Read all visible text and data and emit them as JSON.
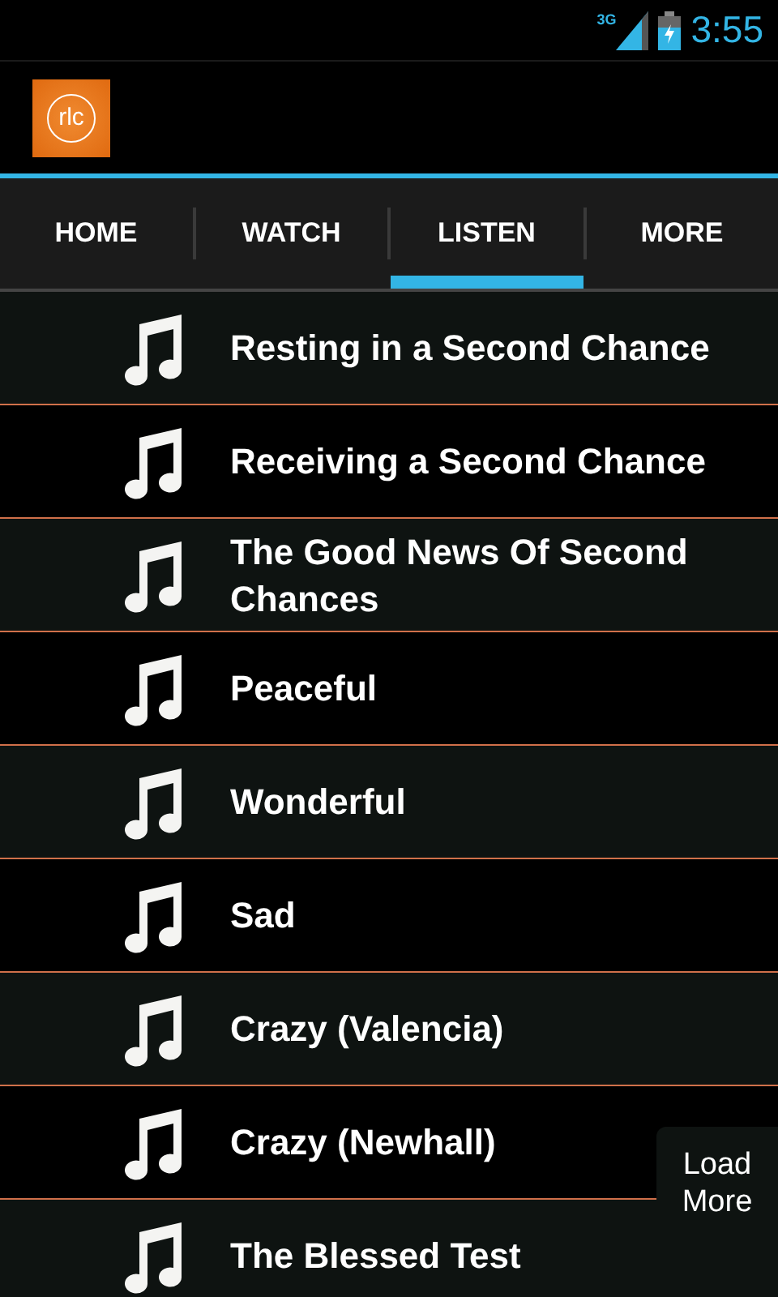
{
  "status_bar": {
    "network": "3G",
    "time": "3:55"
  },
  "app_bar": {
    "logo": "rlc"
  },
  "tabs": [
    {
      "label": "HOME",
      "selected": false
    },
    {
      "label": "WATCH",
      "selected": false
    },
    {
      "label": "LISTEN",
      "selected": true
    },
    {
      "label": "MORE",
      "selected": false
    }
  ],
  "tracks": [
    {
      "title": "Resting in a Second Chance"
    },
    {
      "title": "Receiving a Second Chance"
    },
    {
      "title": "The Good News Of Second Chances"
    },
    {
      "title": "Peaceful"
    },
    {
      "title": "Wonderful"
    },
    {
      "title": "Sad"
    },
    {
      "title": "Crazy (Valencia)"
    },
    {
      "title": "Crazy (Newhall)"
    },
    {
      "title": "The Blessed Test"
    }
  ],
  "load_more_button": "Load More"
}
